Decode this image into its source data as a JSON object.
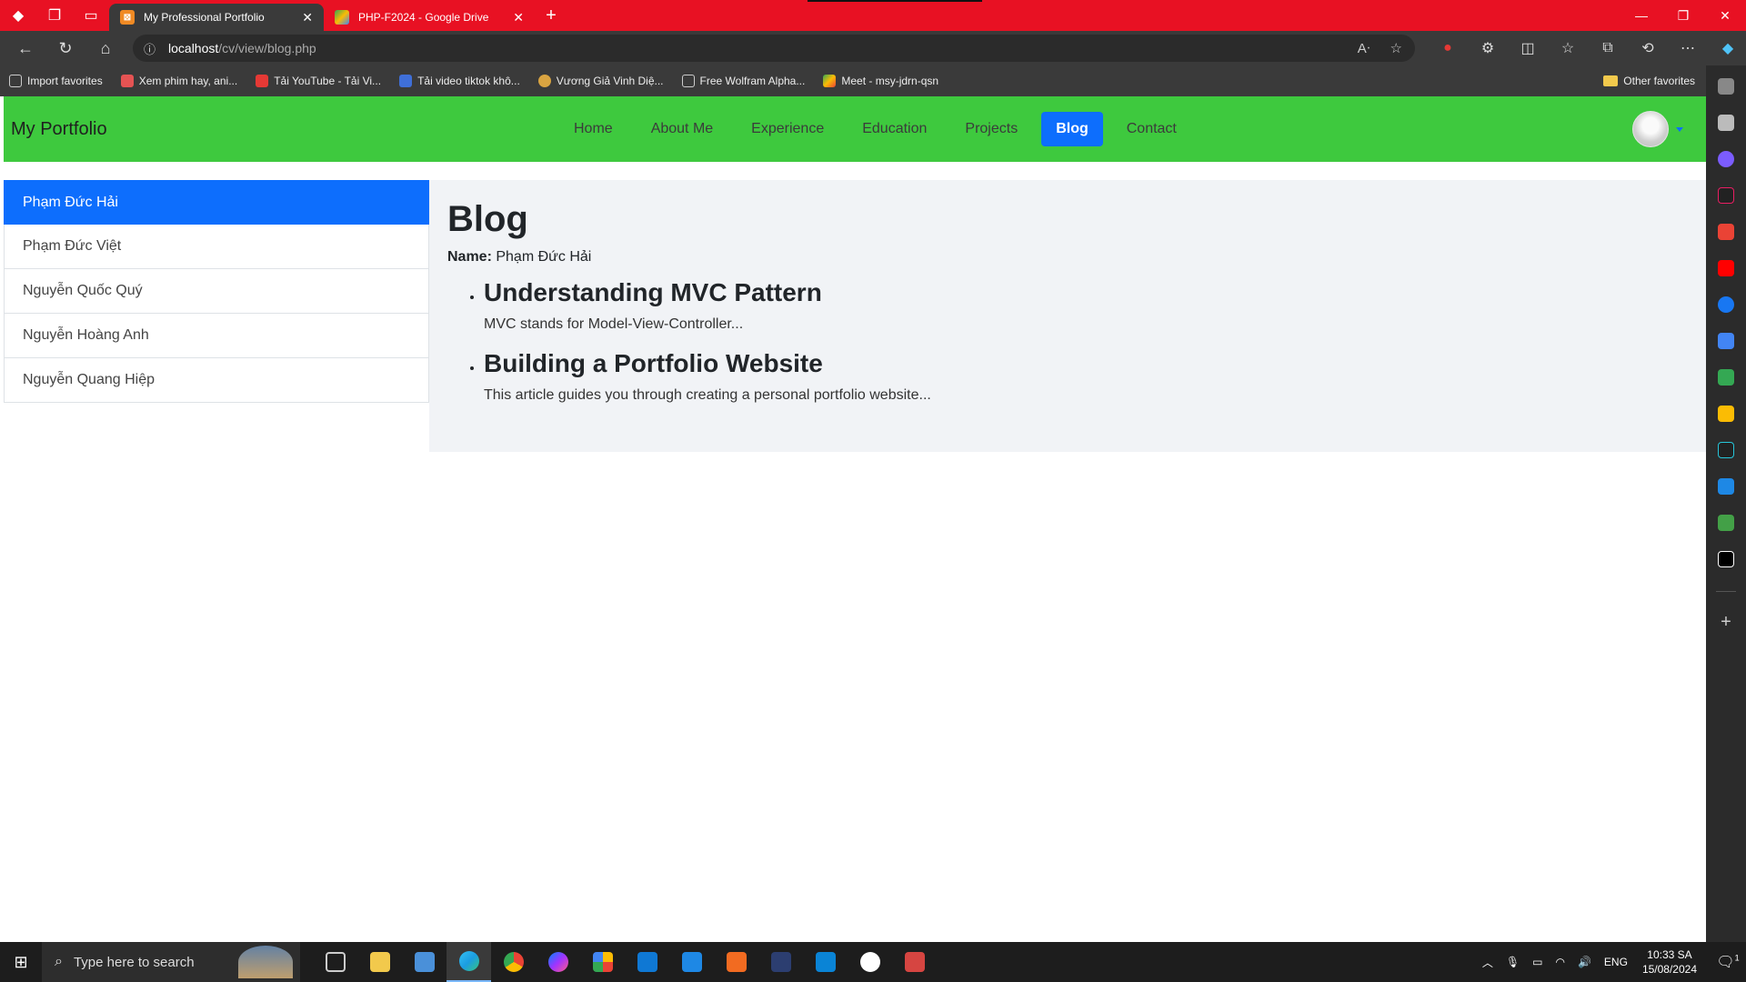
{
  "browser": {
    "tabs": [
      {
        "label": "My Professional Portfolio",
        "active": true
      },
      {
        "label": "PHP-F2024 - Google Drive",
        "active": false
      }
    ],
    "url": {
      "host": "localhost",
      "path": "/cv/view/blog.php"
    },
    "favorites": [
      {
        "label": "Import favorites"
      },
      {
        "label": "Xem phim hay, ani..."
      },
      {
        "label": "Tải YouTube - Tải Vi..."
      },
      {
        "label": "Tải video tiktok khô..."
      },
      {
        "label": "Vương Giả Vinh Diệ..."
      },
      {
        "label": "Free Wolfram Alpha..."
      },
      {
        "label": "Meet - msy-jdrn-qsn"
      }
    ],
    "other_favorites": "Other favorites"
  },
  "site": {
    "brand": "My Portfolio",
    "menu": [
      {
        "label": "Home",
        "active": false
      },
      {
        "label": "About Me",
        "active": false
      },
      {
        "label": "Experience",
        "active": false
      },
      {
        "label": "Education",
        "active": false
      },
      {
        "label": "Projects",
        "active": false
      },
      {
        "label": "Blog",
        "active": true
      },
      {
        "label": "Contact",
        "active": false
      }
    ],
    "accent_color": "#0d6efd",
    "navbar_color": "#3ec93e"
  },
  "sidebar": {
    "members": [
      {
        "label": "Phạm Đức Hải",
        "active": true
      },
      {
        "label": "Phạm Đức Việt",
        "active": false
      },
      {
        "label": "Nguyễn Quốc Quý",
        "active": false
      },
      {
        "label": "Nguyễn Hoàng Anh",
        "active": false
      },
      {
        "label": "Nguyễn Quang Hiệp",
        "active": false
      }
    ]
  },
  "blog": {
    "title": "Blog",
    "name_label": "Name:",
    "name_value": "Phạm Đức Hải",
    "posts": [
      {
        "title": "Understanding MVC Pattern",
        "excerpt": "MVC stands for Model-View-Controller..."
      },
      {
        "title": "Building a Portfolio Website",
        "excerpt": "This article guides you through creating a personal portfolio website..."
      }
    ]
  },
  "taskbar": {
    "search_placeholder": "Type here to search",
    "language": "ENG",
    "time": "10:33 SA",
    "date": "15/08/2024",
    "notification_count": "1"
  }
}
